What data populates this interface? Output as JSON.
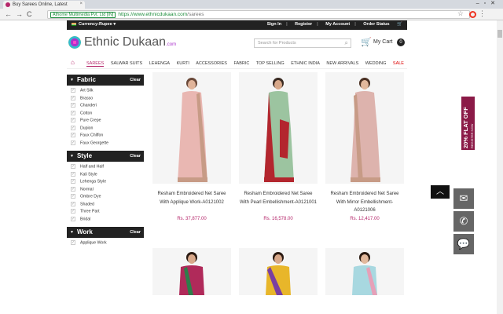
{
  "browser": {
    "tab_title": "Buy Sarees Online, Latest",
    "tab_close": "×",
    "window_controls": "–▫✕",
    "back": "←",
    "forward": "→",
    "reload": "C",
    "secure_label": "Athome Multimedia Pvt. Ltd [IN]",
    "url_host": "https://www.ethnicdukaan.com",
    "url_path": "/sarees",
    "star_icon": "☆",
    "menu_icon": "⋮"
  },
  "topbar": {
    "currency": "Currency:Rupee",
    "links": [
      "Sign In",
      "Register",
      "My Account",
      "Order Status"
    ]
  },
  "header": {
    "logo_text": "Ethnic Dukaan",
    "logo_suffix": ".com",
    "search_placeholder": "Search for Products",
    "cart_label": "My Cart",
    "cart_count": "0"
  },
  "nav": {
    "items": [
      "SAREES",
      "SALWAR SUITS",
      "LEHENGA",
      "KURTI",
      "ACCESSORIES",
      "FABRIC",
      "TOP SELLING",
      "ETHNIC INDIA",
      "NEW ARRIVALS",
      "WEDDING",
      "SALE"
    ]
  },
  "filters": {
    "fabric": {
      "title": "Fabric",
      "clear": "Clear",
      "options": [
        "Art Silk",
        "Brasso",
        "Chanderi",
        "Cotton",
        "Pure Crepe",
        "Dupion",
        "Faux Chiffon",
        "Faux Georgette"
      ]
    },
    "style": {
      "title": "Style",
      "clear": "Clear",
      "options": [
        "Half and Half",
        "Kali Style",
        "Lehenga Style",
        "Normal",
        "Ombre Dye",
        "Shaded",
        "Three Part",
        "Bridal"
      ]
    },
    "work": {
      "title": "Work",
      "clear": "Clear",
      "options": [
        "Applique Work"
      ]
    }
  },
  "products": [
    {
      "name_line1": "Resham Embroidered Net Saree",
      "name_line2": "With Applique Work-A0121002",
      "name_line3": "",
      "price": "Rs. 37,877.00",
      "saree_color": "#e9b7b2",
      "border_color": "#c79b86"
    },
    {
      "name_line1": "Resham Embroidered Net Saree",
      "name_line2": "With Pearl Embellishment-A0121001",
      "name_line3": "",
      "price": "Rs. 16,578.00",
      "saree_color": "#9cc4a0",
      "border_color": "#b3262e"
    },
    {
      "name_line1": "Resham Embroidered Net Saree",
      "name_line2": "With Mirror Embellishment-",
      "name_line3": "A0121006",
      "price": "Rs. 12,417.00",
      "saree_color": "#ddb3ad",
      "border_color": "#c79b86"
    }
  ],
  "floating": {
    "offer_main": "20% FLAT OFF",
    "offer_sub": "REGISTER NOW",
    "back_to_top": "︿",
    "mail_icon": "✉",
    "phone_icon": "✆",
    "chat_icon": "💬"
  },
  "colors": {
    "brand": "#b5276b",
    "dark": "#222222",
    "offer": "#8b1a47"
  }
}
